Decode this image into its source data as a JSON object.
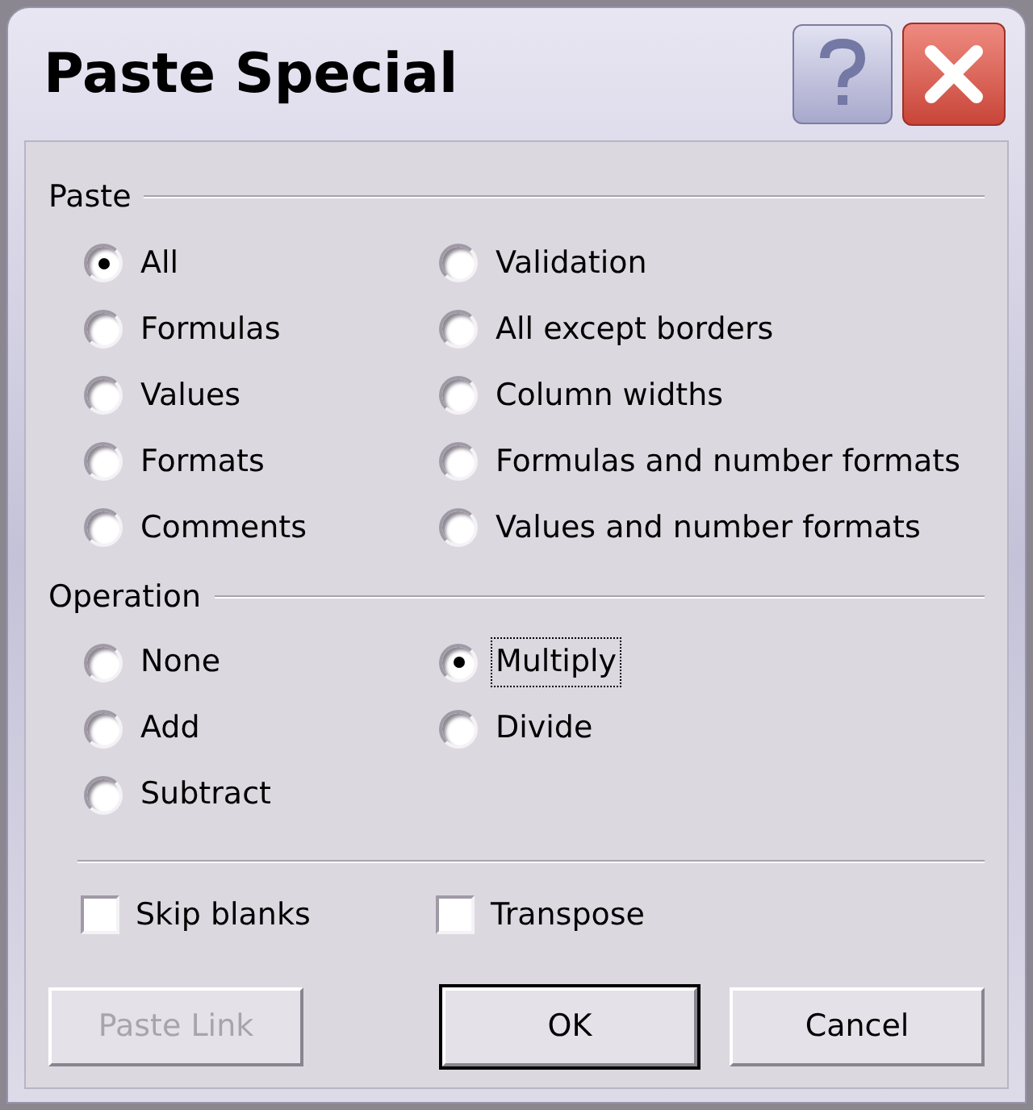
{
  "window": {
    "title": "Paste Special"
  },
  "paste": {
    "label": "Paste",
    "columns": [
      {
        "options": [
          {
            "label": "All",
            "selected": true,
            "focused": false
          },
          {
            "label": "Formulas",
            "selected": false,
            "focused": false
          },
          {
            "label": "Values",
            "selected": false,
            "focused": false
          },
          {
            "label": "Formats",
            "selected": false,
            "focused": false
          },
          {
            "label": "Comments",
            "selected": false,
            "focused": false
          }
        ]
      },
      {
        "options": [
          {
            "label": "Validation",
            "selected": false,
            "focused": false
          },
          {
            "label": "All except borders",
            "selected": false,
            "focused": false
          },
          {
            "label": "Column widths",
            "selected": false,
            "focused": false
          },
          {
            "label": "Formulas and number formats",
            "selected": false,
            "focused": false
          },
          {
            "label": "Values and number formats",
            "selected": false,
            "focused": false
          }
        ]
      }
    ]
  },
  "operation": {
    "label": "Operation",
    "columns": [
      {
        "options": [
          {
            "label": "None",
            "selected": false,
            "focused": false
          },
          {
            "label": "Add",
            "selected": false,
            "focused": false
          },
          {
            "label": "Subtract",
            "selected": false,
            "focused": false
          }
        ]
      },
      {
        "options": [
          {
            "label": "Multiply",
            "selected": true,
            "focused": true
          },
          {
            "label": "Divide",
            "selected": false,
            "focused": false
          }
        ]
      }
    ]
  },
  "checkboxes": [
    {
      "label": "Skip blanks",
      "checked": false
    },
    {
      "label": "Transpose",
      "checked": false
    }
  ],
  "buttons": [
    {
      "label": "Paste Link",
      "disabled": true,
      "default": false
    },
    {
      "label": "OK",
      "disabled": false,
      "default": true
    },
    {
      "label": "Cancel",
      "disabled": false,
      "default": false
    }
  ]
}
